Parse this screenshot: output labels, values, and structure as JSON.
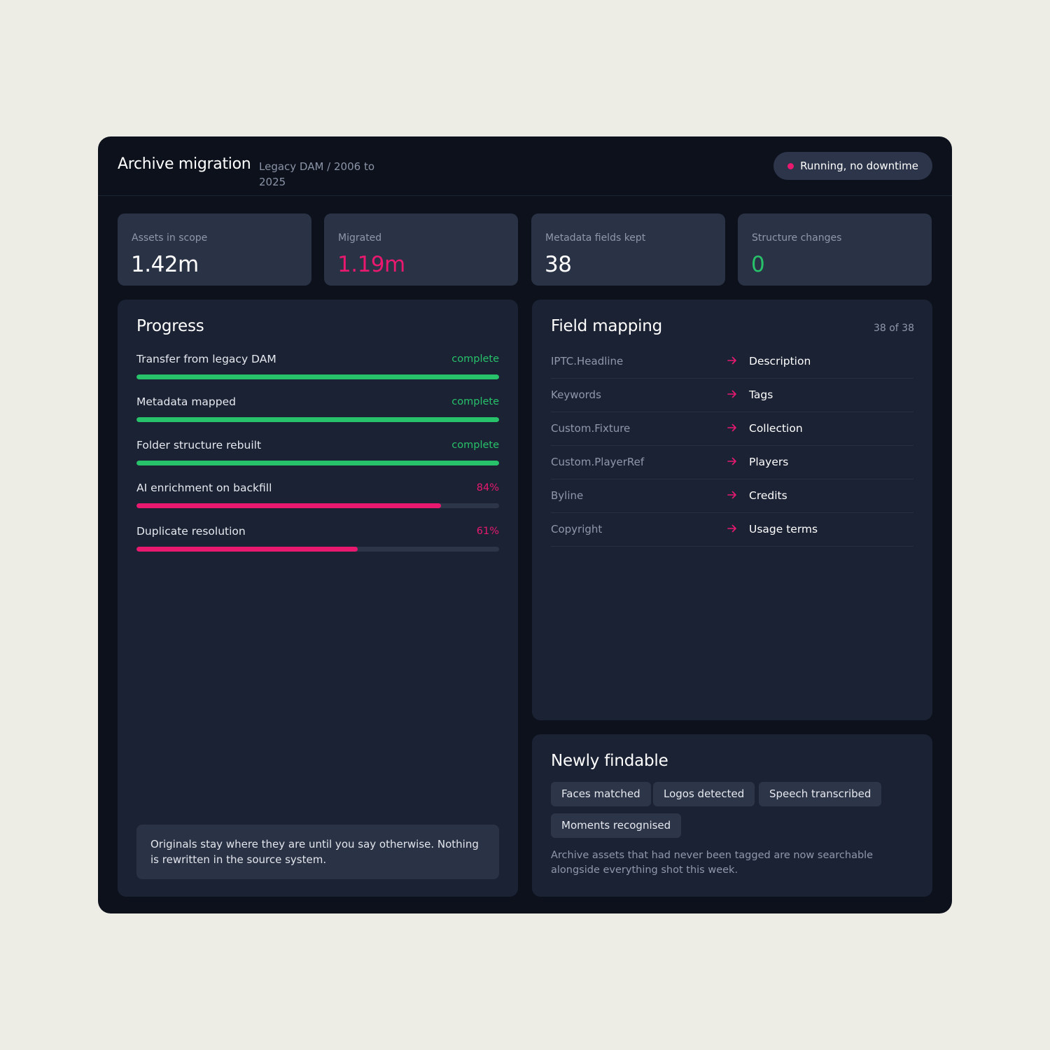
{
  "header": {
    "title": "Archive migration",
    "subtitle": "Legacy DAM / 2006 to 2025",
    "status": "Running, no downtime"
  },
  "kpis": [
    {
      "label": "Assets in scope",
      "value": "1.42m",
      "color": "#ffffff"
    },
    {
      "label": "Migrated",
      "value": "1.19m",
      "color": "#e8196e"
    },
    {
      "label": "Metadata fields kept",
      "value": "38",
      "color": "#ffffff"
    },
    {
      "label": "Structure changes",
      "value": "0",
      "color": "#27c26a"
    }
  ],
  "progress": {
    "title": "Progress",
    "items": [
      {
        "label": "Transfer from legacy DAM",
        "status": "complete",
        "fraction": 1.0,
        "color": "#27c26a"
      },
      {
        "label": "Metadata mapped",
        "status": "complete",
        "fraction": 1.0,
        "color": "#27c26a"
      },
      {
        "label": "Folder structure rebuilt",
        "status": "complete",
        "fraction": 1.0,
        "color": "#27c26a"
      },
      {
        "label": "AI enrichment on backfill",
        "status": "84%",
        "fraction": 0.84,
        "color": "#e8196e"
      },
      {
        "label": "Duplicate resolution",
        "status": "61%",
        "fraction": 0.61,
        "color": "#e8196e"
      }
    ],
    "note": "Originals stay where they are until you say otherwise. Nothing is rewritten in the source system."
  },
  "mapping": {
    "title": "Field mapping",
    "count": "38 of 38",
    "rows": [
      {
        "from": "IPTC.Headline",
        "to": "Description"
      },
      {
        "from": "Keywords",
        "to": "Tags"
      },
      {
        "from": "Custom.Fixture",
        "to": "Collection"
      },
      {
        "from": "Custom.PlayerRef",
        "to": "Players"
      },
      {
        "from": "Byline",
        "to": "Credits"
      },
      {
        "from": "Copyright",
        "to": "Usage terms"
      }
    ],
    "arrow_icon": "arrow-right-icon",
    "arrow_color": "#e8196e"
  },
  "findable": {
    "title": "Newly findable",
    "tags": [
      "Faces matched",
      "Logos detected",
      "Speech transcribed",
      "Moments recognised"
    ],
    "description": "Archive assets that had never been tagged are now searchable alongside everything shot this week."
  },
  "colors": {
    "accent": "#e8196e",
    "success": "#27c26a",
    "background": "#0c111c",
    "panel": "#1b2234",
    "card": "#2a3245"
  }
}
